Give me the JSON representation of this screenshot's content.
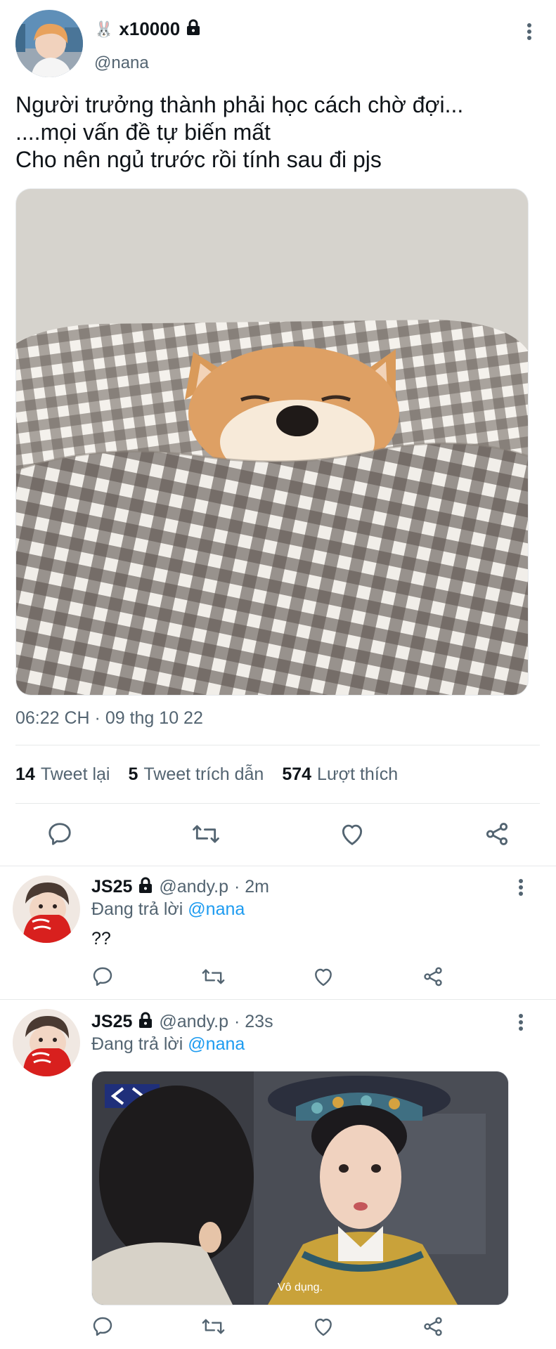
{
  "main_tweet": {
    "author_emoji": "🐰",
    "display_name": "x10000",
    "handle": "@nana",
    "text": "Người trưởng thành phải học cách chờ đợi...\n....mọi vấn đề tự biến mất\nCho nên ngủ trước rồi tính sau đi pjs",
    "timestamp": "06:22 CH · 09 thg 10 22",
    "stats": {
      "retweets_count": "14",
      "retweets_label": "Tweet lại",
      "quotes_count": "5",
      "quotes_label": "Tweet trích dẫn",
      "likes_count": "574",
      "likes_label": "Lượt thích"
    }
  },
  "replies": [
    {
      "display_name": "JS25",
      "handle": "@andy.p",
      "time": "· 2m",
      "replying_label": "Đang trả lời",
      "replying_to": "@nana",
      "text": "??"
    },
    {
      "display_name": "JS25",
      "handle": "@andy.p",
      "time": "· 23s",
      "replying_label": "Đang trả lời",
      "replying_to": "@nana",
      "media_caption": "Vô dụng."
    }
  ],
  "icons": [
    "more-icon",
    "lock-icon",
    "reply-icon",
    "retweet-icon",
    "like-icon",
    "share-icon"
  ],
  "colors": {
    "accent": "#1d9bf0",
    "muted": "#536471",
    "text": "#0f1419",
    "divider": "#e7e9ea"
  }
}
